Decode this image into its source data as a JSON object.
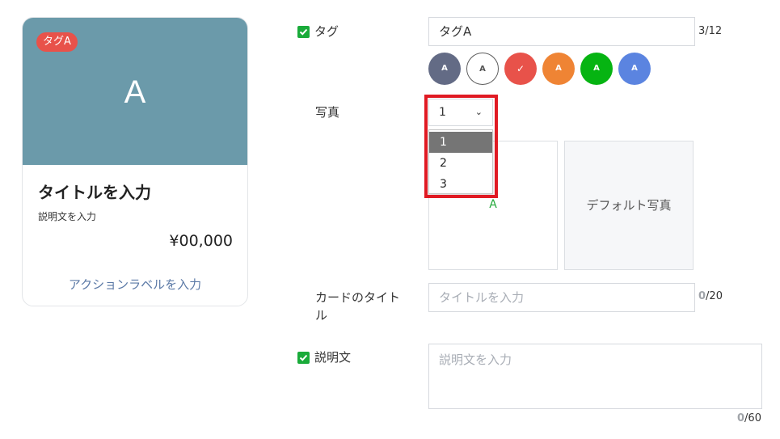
{
  "preview": {
    "tag": "タグA",
    "image_letter": "A",
    "title": "タイトルを入力",
    "description": "説明文を入力",
    "price": "¥00,000",
    "action_label": "アクションラベルを入力",
    "image_color": "#6b9aaa",
    "tag_color": "#e8524a"
  },
  "form": {
    "tag": {
      "label": "タグ",
      "value": "タグA",
      "counter_current": "3",
      "counter_max": "/12",
      "swatches": [
        {
          "text": "A",
          "color": "#636b85"
        },
        {
          "text": "A",
          "color": "#ffffff"
        },
        {
          "text": "✓",
          "color": "#e8524a"
        },
        {
          "text": "A",
          "color": "#ef8434"
        },
        {
          "text": "A",
          "color": "#06b412"
        },
        {
          "text": "A",
          "color": "#5b84e0"
        }
      ]
    },
    "photo": {
      "label": "写真",
      "selected": "1",
      "options": [
        "1",
        "2",
        "3"
      ],
      "box1_letter": "A",
      "box2_caption": "デフォルト写真"
    },
    "card_title": {
      "label_line1": "カードのタイト",
      "label_line2": "ル",
      "placeholder": "タイトルを入力",
      "counter_current": "0",
      "counter_max": "/20"
    },
    "description": {
      "label": "説明文",
      "placeholder": "説明文を入力",
      "counter_current": "0",
      "counter_max": "/60"
    }
  }
}
